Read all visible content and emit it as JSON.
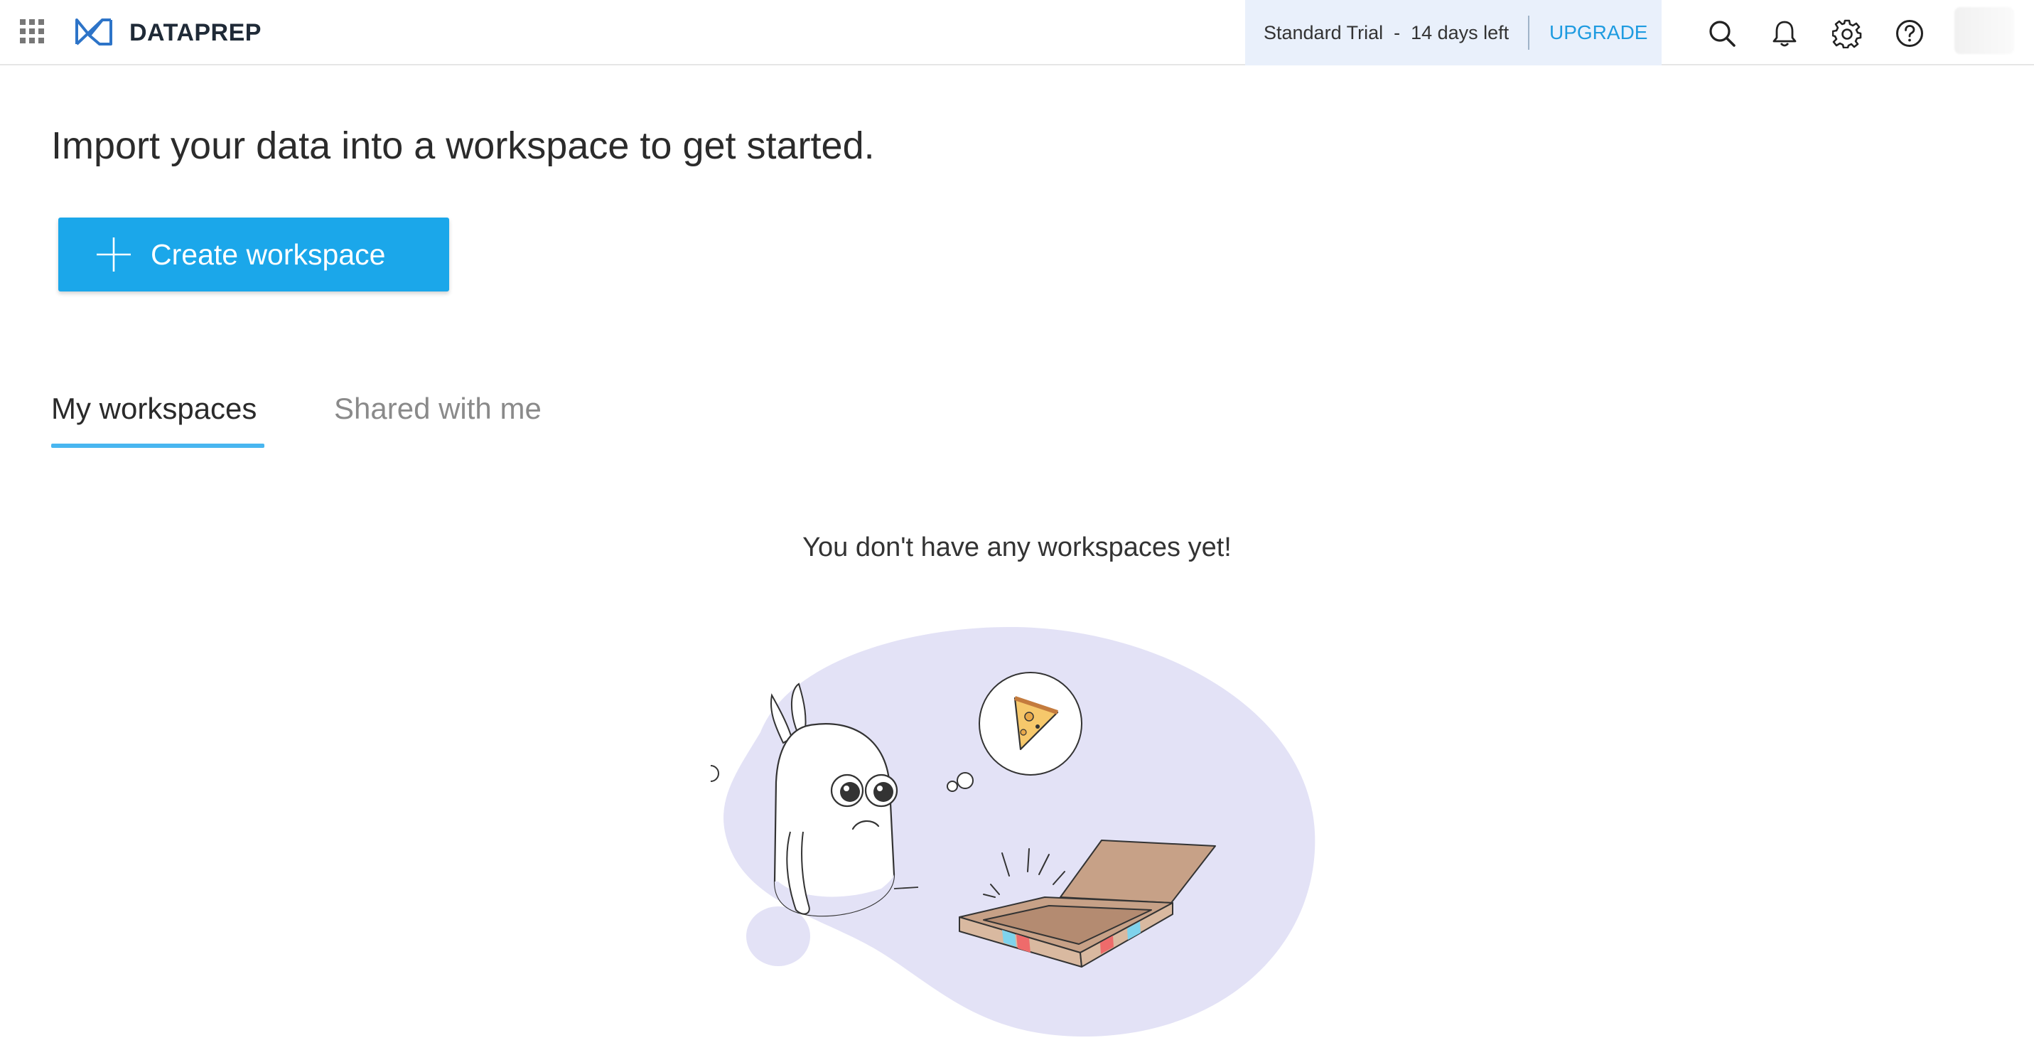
{
  "header": {
    "apps_icon": "apps-grid-icon",
    "brand_name": "DATAPREP",
    "trial_text": "Standard Trial  -  14 days left",
    "upgrade_label": "UPGRADE",
    "icons": [
      "search-icon",
      "bell-icon",
      "gear-icon",
      "help-icon"
    ]
  },
  "main": {
    "headline": "Import your data into a workspace to get started.",
    "create_button_label": "Create workspace",
    "tabs": [
      {
        "label": "My workspaces",
        "active": true
      },
      {
        "label": "Shared with me",
        "active": false
      }
    ],
    "empty_message": "You don't have any workspaces yet!"
  },
  "colors": {
    "accent": "#1ba7ea",
    "tab_underline": "#48b6f0",
    "upgrade_link": "#1e9be0",
    "trial_bg": "#e9f0fb",
    "illustration_blob": "#e3e2f6"
  }
}
